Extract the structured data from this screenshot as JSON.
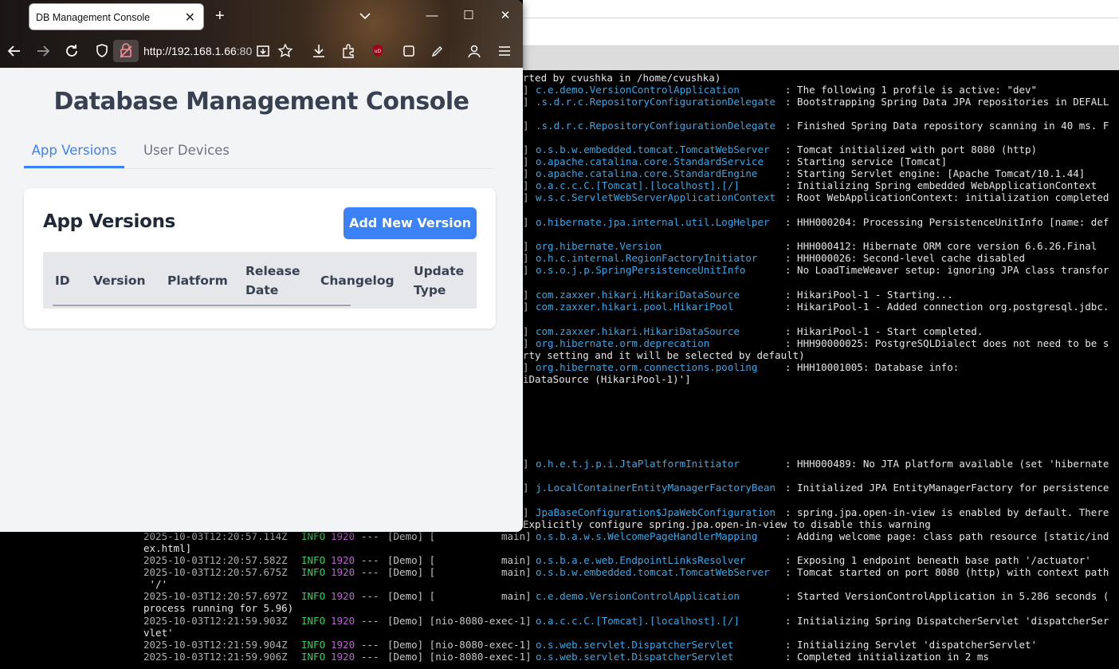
{
  "browser": {
    "tab_title": "DB Management Console",
    "tab_close": "✕",
    "new_tab": "+",
    "url_host": "http://192.168.1.66",
    "url_port": ":80",
    "win_min": "—",
    "win_max": "☐",
    "win_close": "✕"
  },
  "page": {
    "title": "Database Management Console",
    "tabs": [
      {
        "label": "App Versions"
      },
      {
        "label": "User Devices"
      }
    ],
    "card": {
      "title": "App Versions",
      "add_button": "Add New Version",
      "columns": [
        "ID",
        "Version",
        "Platform",
        "Release",
        "Date",
        "Changelog",
        "Update",
        "Type"
      ]
    }
  },
  "terminal": {
    "lines": [
      {
        "full_r": "rted by cvushka in /home/cvushka)"
      },
      {
        "logger": "c.e.demo.VersionControlApplication",
        "msg": ": The following 1 profile is active: \"dev\""
      },
      {
        "logger": ".s.d.r.c.RepositoryConfigurationDelegate",
        "msg": ": Bootstrapping Spring Data JPA repositories in DEFALL"
      },
      {
        "logger": ".s.d.r.c.RepositoryConfigurationDelegate",
        "msg": ": Finished Spring Data repository scanning in 40 ms. F"
      },
      {
        "logger": "o.s.b.w.embedded.tomcat.TomcatWebServer",
        "msg": ": Tomcat initialized with port 8080 (http)"
      },
      {
        "logger": "o.apache.catalina.core.StandardService",
        "msg": ": Starting service [Tomcat]"
      },
      {
        "logger": "o.apache.catalina.core.StandardEngine",
        "msg": ": Starting Servlet engine: [Apache Tomcat/10.1.44]"
      },
      {
        "logger": "o.a.c.c.C.[Tomcat].[localhost].[/]",
        "msg": ": Initializing Spring embedded WebApplicationContext"
      },
      {
        "logger": "w.s.c.ServletWebServerApplicationContext",
        "msg": ": Root WebApplicationContext: initialization completed"
      },
      {
        "logger": "o.hibernate.jpa.internal.util.LogHelper",
        "msg": ": HHH000204: Processing PersistenceUnitInfo [name: def"
      },
      {
        "logger": "org.hibernate.Version",
        "msg": ": HHH000412: Hibernate ORM core version 6.6.26.Final"
      },
      {
        "logger": "o.h.c.internal.RegionFactoryInitiator",
        "msg": ": HHH000026: Second-level cache disabled"
      },
      {
        "logger": "o.s.o.j.p.SpringPersistenceUnitInfo",
        "msg": ": No LoadTimeWeaver setup: ignoring JPA class transfor"
      },
      {
        "logger": "com.zaxxer.hikari.HikariDataSource",
        "msg": ": HikariPool-1 - Starting..."
      },
      {
        "logger": "com.zaxxer.hikari.pool.HikariPool",
        "msg": ": HikariPool-1 - Added connection org.postgresql.jdbc."
      },
      {
        "logger": "com.zaxxer.hikari.HikariDataSource",
        "msg": ": HikariPool-1 - Start completed."
      },
      {
        "logger": "org.hibernate.orm.deprecation",
        "msg": ": HHH90000025: PostgreSQLDialect does not need to be s"
      },
      {
        "full_r": "rty setting and it will be selected by default)"
      },
      {
        "logger": "org.hibernate.orm.connections.pooling",
        "msg": ": HHH10001005: Database info:"
      },
      {
        "full_r": "iDataSource (HikariPool-1)']"
      },
      {
        "logger": "o.h.e.t.j.p.i.JtaPlatformInitiator",
        "msg": ": HHH000489: No JTA platform available (set 'hibernate"
      },
      {
        "logger": "j.LocalContainerEntityManagerFactoryBean",
        "msg": ": Initialized JPA EntityManagerFactory for persistence"
      },
      {
        "logger": "JpaBaseConfiguration$JpaWebConfiguration",
        "msg": ": spring.jpa.open-in-view is enabled by default. There"
      },
      {
        "full_r": "Explicitly configure spring.jpa.open-in-view to disable this warning"
      },
      {
        "ts": "2025-10-03T12:20:57.114Z",
        "lvl": "INFO",
        "pid": "1920",
        "dash": "---",
        "thr": "[Demo] [           main]",
        "logger": "o.s.b.a.w.s.WelcomePageHandlerMapping",
        "msg": ": Adding welcome page: class path resource [static/ind"
      },
      {
        "full": "ex.html]"
      },
      {
        "ts": "2025-10-03T12:20:57.582Z",
        "lvl": "INFO",
        "pid": "1920",
        "dash": "---",
        "thr": "[Demo] [           main]",
        "logger": "o.s.b.a.e.web.EndpointLinksResolver",
        "msg": ": Exposing 1 endpoint beneath base path '/actuator'"
      },
      {
        "ts": "2025-10-03T12:20:57.675Z",
        "lvl": "INFO",
        "pid": "1920",
        "dash": "---",
        "thr": "[Demo] [           main]",
        "logger": "o.s.b.w.embedded.tomcat.TomcatWebServer",
        "msg": ": Tomcat started on port 8080 (http) with context path"
      },
      {
        "full": " '/'"
      },
      {
        "ts": "2025-10-03T12:20:57.697Z",
        "lvl": "INFO",
        "pid": "1920",
        "dash": "---",
        "thr": "[Demo] [           main]",
        "logger": "c.e.demo.VersionControlApplication",
        "msg": ": Started VersionControlApplication in 5.286 seconds ("
      },
      {
        "full": "process running for 5.96)"
      },
      {
        "ts": "2025-10-03T12:21:59.903Z",
        "lvl": "INFO",
        "pid": "1920",
        "dash": "---",
        "thr": "[Demo] [nio-8080-exec-1]",
        "logger": "o.a.c.c.C.[Tomcat].[localhost].[/]",
        "msg": ": Initializing Spring DispatcherServlet 'dispatcherSer"
      },
      {
        "full": "vlet'"
      },
      {
        "ts": "2025-10-03T12:21:59.904Z",
        "lvl": "INFO",
        "pid": "1920",
        "dash": "---",
        "thr": "[Demo] [nio-8080-exec-1]",
        "logger": "o.s.web.servlet.DispatcherServlet",
        "msg": ": Initializing Servlet 'dispatcherServlet'"
      },
      {
        "ts": "2025-10-03T12:21:59.906Z",
        "lvl": "INFO",
        "pid": "1920",
        "dash": "---",
        "thr": "[Demo] [nio-8080-exec-1]",
        "logger": "o.s.web.servlet.DispatcherServlet",
        "msg": ": Completed initialization in 2 ms"
      }
    ]
  }
}
